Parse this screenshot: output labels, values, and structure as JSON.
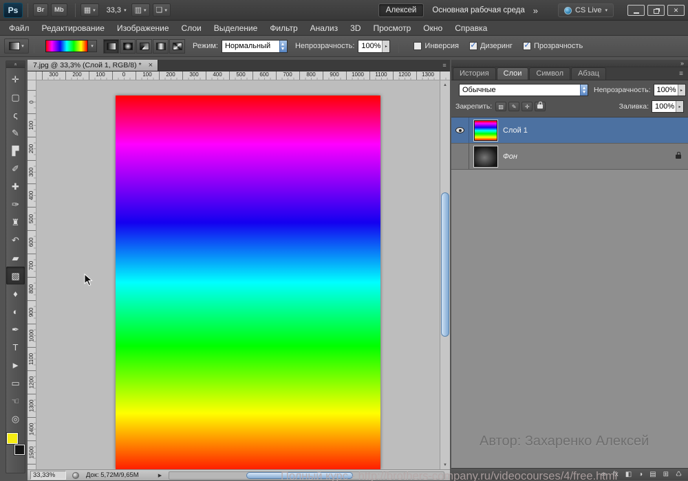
{
  "app_bar": {
    "logo": "Ps",
    "bridge_label": "Br",
    "mini_bridge_label": "Mb",
    "zoom_value": "33,3",
    "workspace_active": "Алексей",
    "workspace_main": "Основная рабочая среда",
    "workspace_overflow": "»",
    "cs_live_label": "CS Live"
  },
  "menu": {
    "items": [
      {
        "name": "menu-file",
        "label": "Файл"
      },
      {
        "name": "menu-edit",
        "label": "Редактирование"
      },
      {
        "name": "menu-image",
        "label": "Изображение"
      },
      {
        "name": "menu-layers",
        "label": "Слои"
      },
      {
        "name": "menu-select",
        "label": "Выделение"
      },
      {
        "name": "menu-filter",
        "label": "Фильтр"
      },
      {
        "name": "menu-analysis",
        "label": "Анализ"
      },
      {
        "name": "menu-3d",
        "label": "3D"
      },
      {
        "name": "menu-view",
        "label": "Просмотр"
      },
      {
        "name": "menu-window",
        "label": "Окно"
      },
      {
        "name": "menu-help",
        "label": "Справка"
      }
    ]
  },
  "options_bar": {
    "mode_label": "Режим:",
    "mode_value": "Нормальный",
    "opacity_label": "Непрозрачность:",
    "opacity_value": "100%",
    "checkboxes": [
      {
        "name": "invert-checkbox",
        "label": "Инверсия",
        "checked": false
      },
      {
        "name": "dither-checkbox",
        "label": "Дизеринг",
        "checked": true
      },
      {
        "name": "transparency-checkbox",
        "label": "Прозрачность",
        "checked": true
      }
    ]
  },
  "tools": {
    "items": [
      {
        "name": "move-tool",
        "glyph": "✛"
      },
      {
        "name": "marquee-tool",
        "glyph": "▢"
      },
      {
        "name": "lasso-tool",
        "glyph": "ς"
      },
      {
        "name": "quick-selection-tool",
        "glyph": "✎"
      },
      {
        "name": "crop-tool",
        "glyph": "▛"
      },
      {
        "name": "eyedropper-tool",
        "glyph": "✐"
      },
      {
        "name": "healing-brush-tool",
        "glyph": "✚"
      },
      {
        "name": "brush-tool",
        "glyph": "✑"
      },
      {
        "name": "clone-stamp-tool",
        "glyph": "♜"
      },
      {
        "name": "history-brush-tool",
        "glyph": "↶"
      },
      {
        "name": "eraser-tool",
        "glyph": "▰"
      },
      {
        "name": "gradient-tool",
        "glyph": "▧",
        "selected": true
      },
      {
        "name": "blur-tool",
        "glyph": "♦"
      },
      {
        "name": "dodge-tool",
        "glyph": "◐"
      },
      {
        "name": "pen-tool",
        "glyph": "✒"
      },
      {
        "name": "type-tool",
        "glyph": "T"
      },
      {
        "name": "path-selection-tool",
        "glyph": "►"
      },
      {
        "name": "shape-t ool",
        "glyph": "▭"
      },
      {
        "name": "hand-tool",
        "glyph": "☜"
      },
      {
        "name": "zoom-tool",
        "glyph": "◎"
      }
    ]
  },
  "document": {
    "tab_title": "7.jpg @ 33,3% (Слой 1, RGB/8) *",
    "tab_close_glyph": "×",
    "ruler_h": [
      "300",
      "200",
      "100",
      "0",
      "100",
      "200",
      "300",
      "400",
      "500",
      "600",
      "700",
      "800",
      "900",
      "1000",
      "1100",
      "1200",
      "1300"
    ],
    "ruler_v": [
      "0",
      "100",
      "200",
      "300",
      "400",
      "500",
      "600",
      "700",
      "800",
      "900",
      "1000",
      "1100",
      "1200",
      "1300",
      "1400",
      "1500"
    ],
    "status_zoom": "33,33%",
    "status_doc": "Док: 5,72М/9,65М"
  },
  "dock": {
    "tabs": [
      {
        "name": "tab-history",
        "label": "История"
      },
      {
        "name": "tab-layers",
        "label": "Слои",
        "active": true
      },
      {
        "name": "tab-character",
        "label": "Символ"
      },
      {
        "name": "tab-paragraph",
        "label": "Абзац"
      }
    ],
    "layers_panel": {
      "blend_mode_value": "Обычные",
      "opacity_label": "Непрозрачность:",
      "opacity_value": "100%",
      "lock_label": "Закрепить:",
      "lock_buttons": [
        {
          "name": "lock-transparency-button",
          "glyph": "▨"
        },
        {
          "name": "lock-pixels-button",
          "glyph": "✎"
        },
        {
          "name": "lock-position-button",
          "glyph": "✛"
        }
      ],
      "fill_label": "Заливка:",
      "fill_value": "100%",
      "layers": [
        {
          "name": "Слой 1"
        },
        {
          "name": "Фон"
        }
      ],
      "footer_icons": [
        {
          "name": "link-layers-button",
          "glyph": "∞"
        },
        {
          "name": "layer-style-button",
          "glyph": "fx"
        },
        {
          "name": "layer-mask-button",
          "glyph": "◧"
        },
        {
          "name": "adjustment-layer-button",
          "glyph": "◑"
        },
        {
          "name": "layer-group-button",
          "glyph": "▤"
        },
        {
          "name": "new-layer-button",
          "glyph": "⊞"
        },
        {
          "name": "delete-layer-button",
          "glyph": "♺"
        }
      ]
    }
  },
  "icons": {
    "dropdown": "▾",
    "field_arrow": "▸",
    "grid": "▦",
    "arrange": "▥",
    "screen_mode": "❏",
    "check": "✓",
    "close": "✕",
    "double_chevron": "»",
    "panel_menu": "≡",
    "scroll_up": "▲",
    "scroll_down": "▼",
    "status_menu": "▶"
  },
  "watermarks": {
    "author": "Автор: Захаренко Алексей",
    "course": "Полный курс - http://brothers-company.ru/videocourses/4/free.html"
  },
  "colors": {
    "selection_blue": "#4c71a1",
    "accent_blue": "#1e5bbf",
    "foreground_swatch": "#f6ec13",
    "canvas_background": "#bdbdbd",
    "ui_chrome": "#535353"
  }
}
